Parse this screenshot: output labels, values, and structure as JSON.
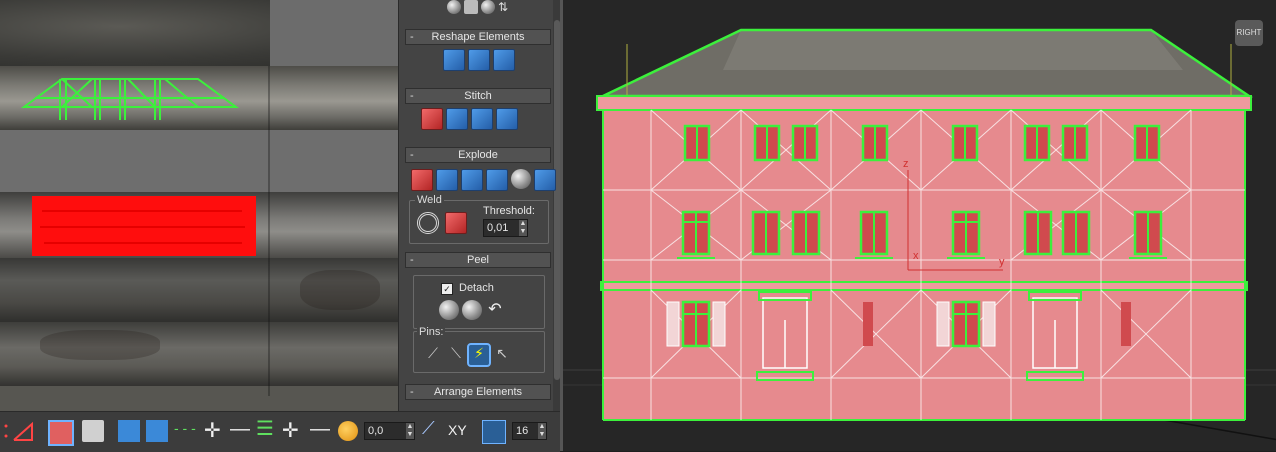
{
  "panel": {
    "rollouts": {
      "reshape": "Reshape Elements",
      "stitch": "Stitch",
      "explode": "Explode",
      "peel": "Peel",
      "arrange": "Arrange Elements"
    },
    "collapse_glyph": "-",
    "weld_group": "Weld",
    "threshold_label": "Threshold:",
    "threshold_value": "0,01",
    "detach_label": "Detach",
    "detach_checked": true,
    "pins_group": "Pins:"
  },
  "toolbar": {
    "spinner_value": "0,0",
    "xy_label": "XY",
    "grid_value": "16"
  },
  "viewport": {
    "nav_label": "RIGHT",
    "axis_z": "z",
    "axis_x": "x",
    "axis_y": "y"
  },
  "colors": {
    "selection_green": "#3cf03c",
    "selection_red": "#ff0d0d",
    "facade_pink": "#e68a8e",
    "panel_bg": "#444444",
    "active_blue": "#2a5f96"
  }
}
